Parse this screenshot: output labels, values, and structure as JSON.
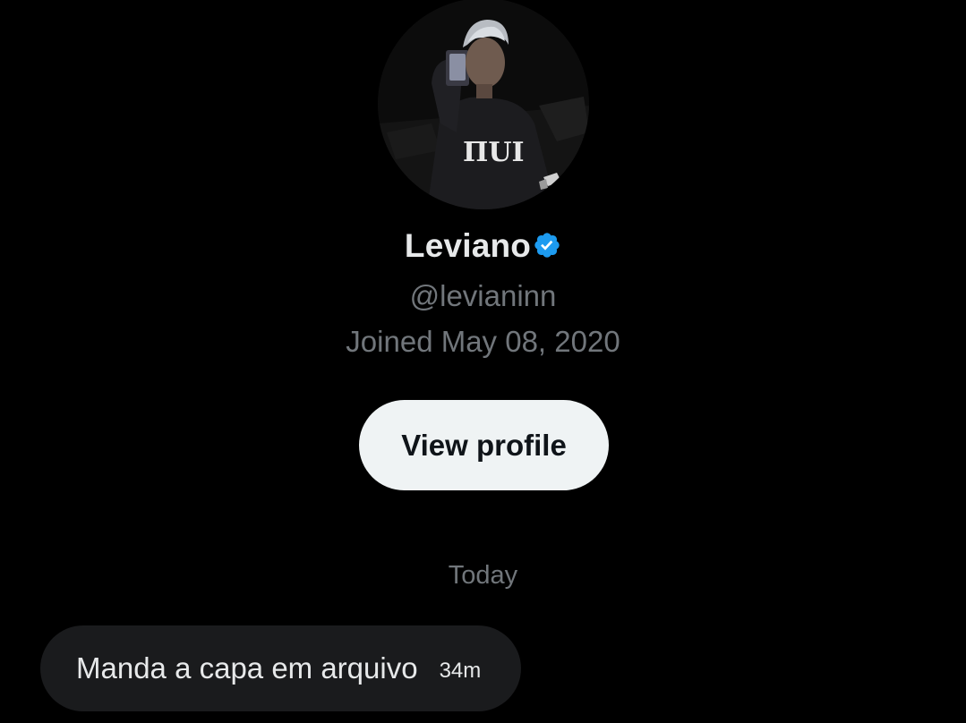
{
  "profile": {
    "name": "Leviano",
    "handle": "@levianinn",
    "joined": "Joined May 08, 2020",
    "verified_icon": "verified-badge-icon",
    "verified_color": "#1d9bf0"
  },
  "actions": {
    "view_profile_label": "View profile"
  },
  "conversation": {
    "date_separator": "Today",
    "messages": [
      {
        "text": "Manda a capa em arquivo",
        "time": "34m"
      }
    ]
  },
  "colors": {
    "background": "#000000",
    "primary_text": "#e7e9ea",
    "secondary_text": "#71767b",
    "button_bg": "#eff3f4",
    "bubble_bg": "#1a1b1d"
  }
}
